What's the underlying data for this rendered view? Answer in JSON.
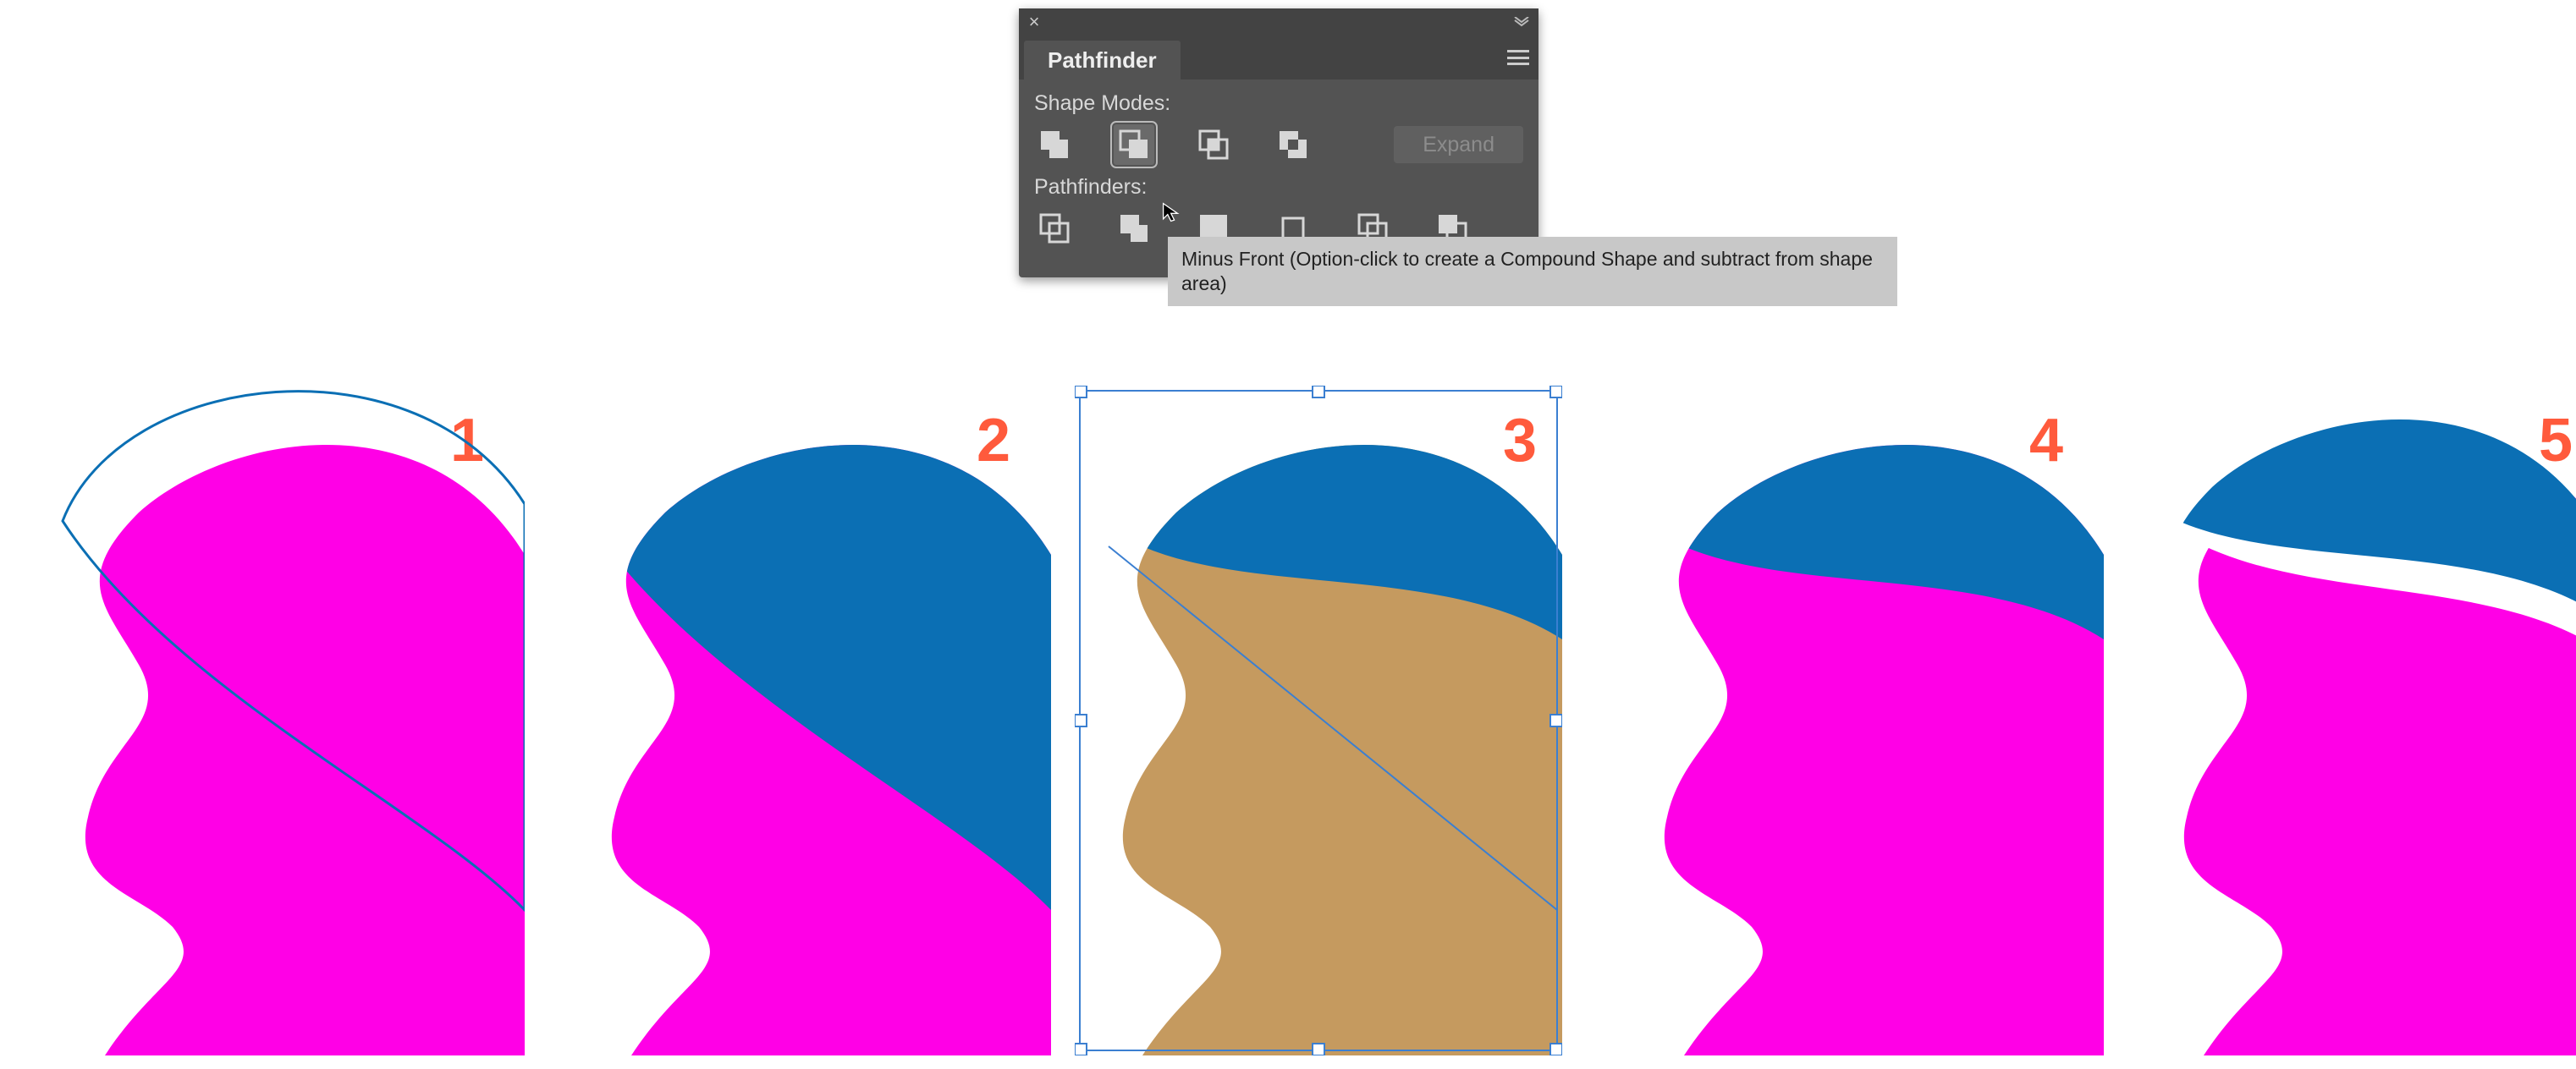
{
  "panel": {
    "title": "Pathfinder",
    "shape_modes_label": "Shape Modes:",
    "pathfinders_label": "Pathfinders:",
    "expand_label": "Expand",
    "tooltip": "Minus Front (Option-click to create a Compound Shape and subtract from shape area)"
  },
  "steps": {
    "n1": "1",
    "n2": "2",
    "n3": "3",
    "n4": "4",
    "n5": "5"
  },
  "colors": {
    "pink": "#ff00e6",
    "blue": "#0b6fb4",
    "tan": "#c59a5f",
    "selBlue": "#3b7fd1",
    "red": "#ff5a3c"
  }
}
